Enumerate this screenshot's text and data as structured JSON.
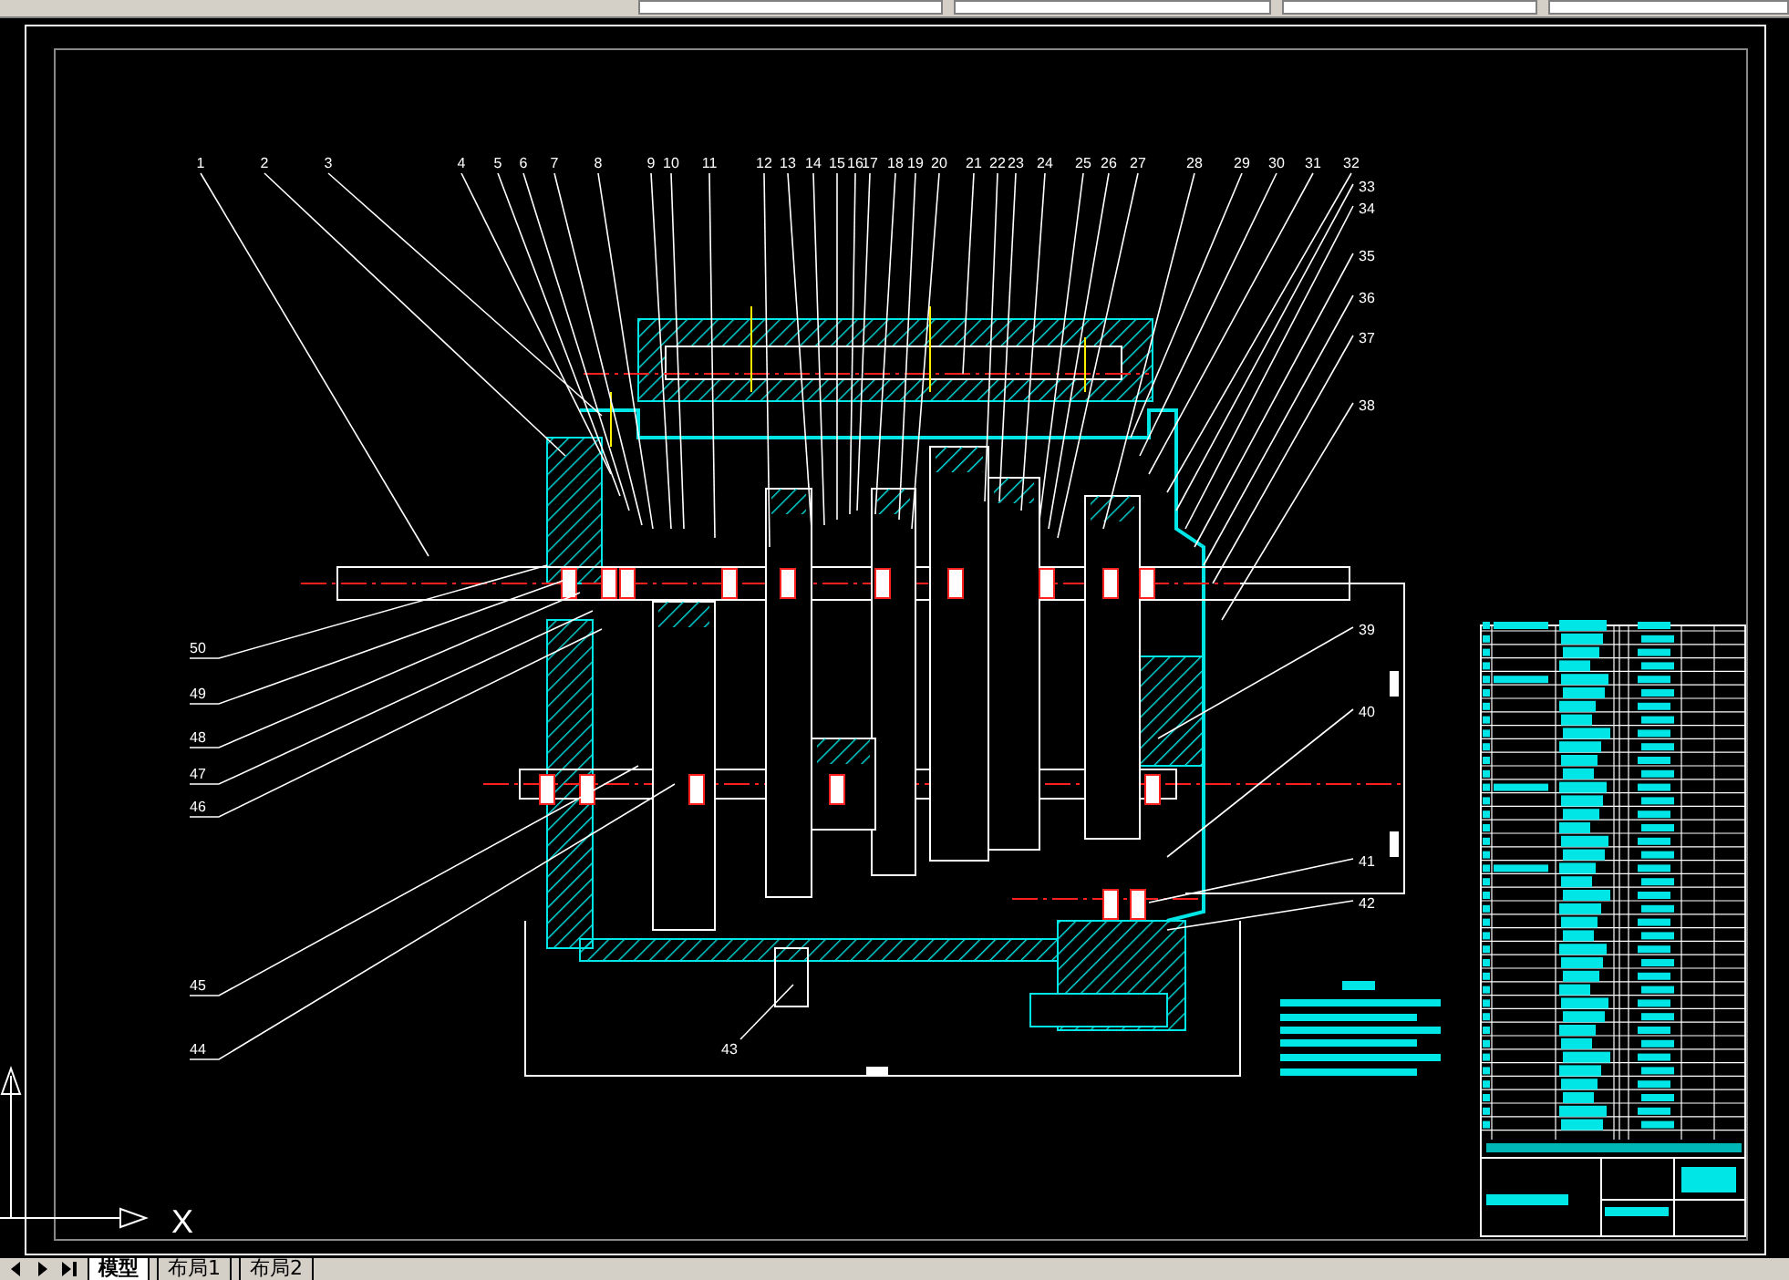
{
  "drawing": {
    "top_labels": [
      "1",
      "2",
      "3",
      "4",
      "5",
      "6",
      "7",
      "8",
      "9",
      "10",
      "11",
      "12",
      "13",
      "14",
      "15",
      "16",
      "17",
      "18",
      "19",
      "20",
      "21",
      "22",
      "23",
      "24",
      "25",
      "26",
      "27",
      "28",
      "29",
      "30",
      "31",
      "32"
    ],
    "right_labels": [
      "33",
      "34",
      "35",
      "36",
      "37",
      "38",
      "39",
      "40",
      "41",
      "42"
    ],
    "left_labels": [
      "50",
      "49",
      "48",
      "47",
      "46",
      "45",
      "44"
    ],
    "bottom_label": "43",
    "ucs_axis_label": "X"
  },
  "layout_tabs": [
    {
      "label": "模型",
      "selected": true
    },
    {
      "label": "布局1",
      "selected": false
    },
    {
      "label": "布局2",
      "selected": false
    }
  ]
}
